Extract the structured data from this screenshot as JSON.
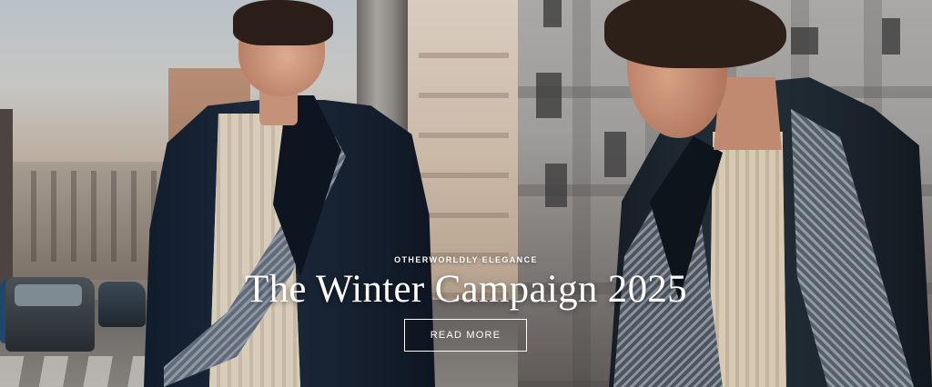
{
  "hero": {
    "eyebrow": "OTHERWORLDLY ELEGANCE",
    "title": "The Winter Campaign 2025",
    "cta_label": "READ MORE"
  },
  "colors": {
    "text": "#ffffff",
    "cta_border": "#ffffff"
  }
}
